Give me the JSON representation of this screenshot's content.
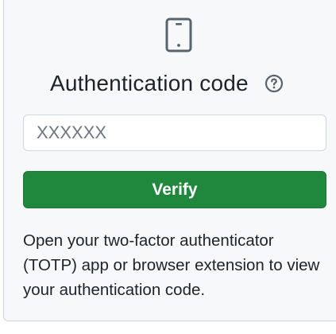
{
  "icons": {
    "device": "mobile-device-icon",
    "help": "question-circle-icon"
  },
  "colors": {
    "card_background": "#f6f8fa",
    "border": "#d0d7de",
    "primary_button": "#1f883d",
    "text": "#1f2328",
    "muted_icon": "#59636e"
  },
  "auth": {
    "title": "Authentication code",
    "code_placeholder": "XXXXXX",
    "code_value": "",
    "verify_label": "Verify",
    "help_text": "Open your two-factor authenticator (TOTP) app or browser extension to view your authentication code."
  }
}
